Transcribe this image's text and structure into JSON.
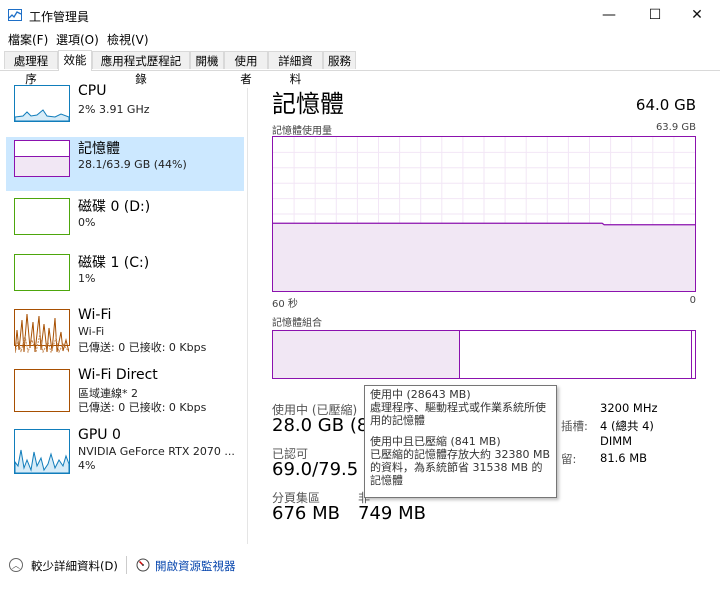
{
  "window": {
    "title": "工作管理員",
    "controls": {
      "minimize": "—",
      "maximize": "☐",
      "close": "✕"
    }
  },
  "menu": [
    {
      "label": "檔案(F)"
    },
    {
      "label": "選項(O)"
    },
    {
      "label": "檢視(V)"
    }
  ],
  "tabs": [
    {
      "label": "處理程序"
    },
    {
      "label": "效能",
      "active": true
    },
    {
      "label": "應用程式歷程記錄"
    },
    {
      "label": "開機"
    },
    {
      "label": "使用者"
    },
    {
      "label": "詳細資料"
    },
    {
      "label": "服務"
    }
  ],
  "sidebar": [
    {
      "title": "CPU",
      "line1": "2%  3.91 GHz",
      "line2": "",
      "color": "#117dbb"
    },
    {
      "title": "記憶體",
      "line1": "28.1/63.9 GB (44%)",
      "line2": "",
      "color": "#8b12ae",
      "active": true
    },
    {
      "title": "磁碟 0 (D:)",
      "line1": "0%",
      "line2": "",
      "color": "#4da60c"
    },
    {
      "title": "磁碟 1 (C:)",
      "line1": "1%",
      "line2": "",
      "color": "#4da60c"
    },
    {
      "title": "Wi-Fi",
      "line1": "Wi-Fi",
      "line2": "已傳送: 0  已接收: 0 Kbps",
      "color": "#a74f01"
    },
    {
      "title": "Wi-Fi Direct",
      "line1": "區域連線* 2",
      "line2": "已傳送: 0  已接收: 0 Kbps",
      "color": "#a74f01"
    },
    {
      "title": "GPU 0",
      "line1": "NVIDIA GeForce RTX 2070 ...",
      "line2": "4%",
      "color": "#117dbb"
    }
  ],
  "memory": {
    "title": "記憶體",
    "total": "64.0 GB",
    "usage_label": "記憶體使用量",
    "usage_max": "63.9 GB",
    "time_left": "60 秒",
    "time_right": "0",
    "usage_fraction": 0.44,
    "composition_label": "記憶體組合",
    "composition_in_use_fraction": 0.44,
    "accent": "#8b12ae"
  },
  "stats": {
    "in_use_label": "使用中 (已壓縮)",
    "in_use_value": "28.0 GB (84",
    "available_label": "已認可",
    "available_value": "69.0/79.5 G",
    "cached_label": "分頁集區",
    "cached_value": "676 MB",
    "nonpaged_label": "非",
    "nonpaged_value": "749 MB",
    "speed_value": "3200 MHz",
    "slots_label": "插槽:",
    "slots_value": "4 (總共 4)",
    "form_value": "DIMM",
    "reserved_label": "留:",
    "reserved_value": "81.6 MB"
  },
  "tooltip": {
    "line1": "使用中 (28643 MB)",
    "line2": "處理程序、驅動程式或作業系統所使用的記憶體",
    "line3": "使用中且已壓縮 (841 MB)",
    "line4": "已壓縮的記憶體存放大約 32380 MB 的資料，為系統節省 31538 MB 的記憶體"
  },
  "footer": {
    "less_details": "較少詳細資料(D)",
    "open_monitor": "開啟資源監視器"
  }
}
